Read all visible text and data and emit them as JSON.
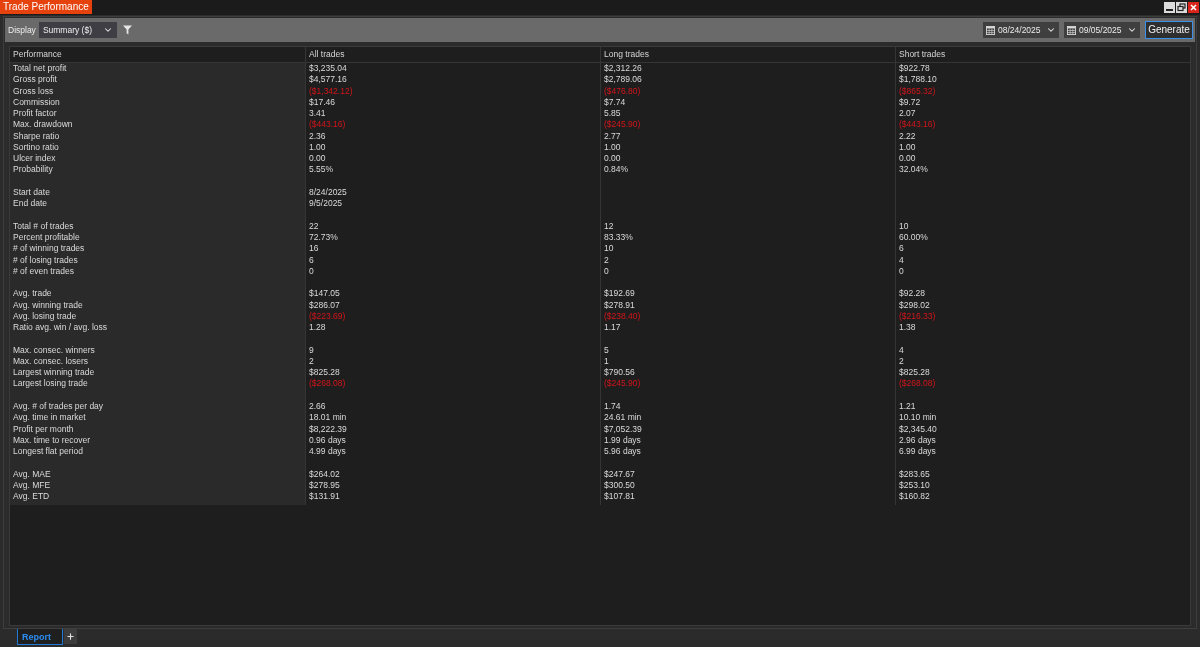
{
  "window": {
    "title": "Trade Performance"
  },
  "toolbar": {
    "display_label": "Display",
    "display_value": "Summary ($)",
    "dates": [
      "08/24/2025",
      "09/05/2025"
    ],
    "generate_button": "Generate"
  },
  "table": {
    "columns": [
      "Performance",
      "All trades",
      "Long trades",
      "Short trades"
    ],
    "sections": [
      {
        "rows": [
          {
            "label": "Total net profit",
            "values": [
              "$3,235.04",
              "$2,312.26",
              "$922.78"
            ],
            "negative": false
          },
          {
            "label": "Gross profit",
            "values": [
              "$4,577.16",
              "$2,789.06",
              "$1,788.10"
            ],
            "negative": false
          },
          {
            "label": "Gross loss",
            "values": [
              "($1,342.12)",
              "($476.80)",
              "($865.32)"
            ],
            "negative": true
          },
          {
            "label": "Commission",
            "values": [
              "$17.46",
              "$7.74",
              "$9.72"
            ],
            "negative": false
          },
          {
            "label": "Profit factor",
            "values": [
              "3.41",
              "5.85",
              "2.07"
            ],
            "negative": false
          },
          {
            "label": "Max. drawdown",
            "values": [
              "($443.16)",
              "($245.90)",
              "($443.16)"
            ],
            "negative": true
          },
          {
            "label": "Sharpe ratio",
            "values": [
              "2.36",
              "2.77",
              "2.22"
            ],
            "negative": false
          },
          {
            "label": "Sortino ratio",
            "values": [
              "1.00",
              "1.00",
              "1.00"
            ],
            "negative": false
          },
          {
            "label": "Ulcer index",
            "values": [
              "0.00",
              "0.00",
              "0.00"
            ],
            "negative": false
          },
          {
            "label": "Probability",
            "values": [
              "5.55%",
              "0.84%",
              "32.04%"
            ],
            "negative": false
          }
        ]
      },
      {
        "rows": [
          {
            "label": "Start date",
            "values": [
              "8/24/2025"
            ],
            "negative": false
          },
          {
            "label": "End date",
            "values": [
              "9/5/2025"
            ],
            "negative": false
          }
        ]
      },
      {
        "rows": [
          {
            "label": "Total # of trades",
            "values": [
              "22",
              "12",
              "10"
            ],
            "negative": false
          },
          {
            "label": "Percent profitable",
            "values": [
              "72.73%",
              "83.33%",
              "60.00%"
            ],
            "negative": false
          },
          {
            "label": "# of winning trades",
            "values": [
              "16",
              "10",
              "6"
            ],
            "negative": false
          },
          {
            "label": "# of losing trades",
            "values": [
              "6",
              "2",
              "4"
            ],
            "negative": false
          },
          {
            "label": "# of even trades",
            "values": [
              "0",
              "0",
              "0"
            ],
            "negative": false
          }
        ]
      },
      {
        "rows": [
          {
            "label": "Avg. trade",
            "values": [
              "$147.05",
              "$192.69",
              "$92.28"
            ],
            "negative": false
          },
          {
            "label": "Avg. winning trade",
            "values": [
              "$286.07",
              "$278.91",
              "$298.02"
            ],
            "negative": false
          },
          {
            "label": "Avg. losing trade",
            "values": [
              "($223.69)",
              "($238.40)",
              "($216.33)"
            ],
            "negative": true
          },
          {
            "label": "Ratio avg. win / avg. loss",
            "values": [
              "1.28",
              "1.17",
              "1.38"
            ],
            "negative": false
          }
        ]
      },
      {
        "rows": [
          {
            "label": "Max. consec. winners",
            "values": [
              "9",
              "5",
              "4"
            ],
            "negative": false
          },
          {
            "label": "Max. consec. losers",
            "values": [
              "2",
              "1",
              "2"
            ],
            "negative": false
          },
          {
            "label": "Largest winning trade",
            "values": [
              "$825.28",
              "$790.56",
              "$825.28"
            ],
            "negative": false
          },
          {
            "label": "Largest losing trade",
            "values": [
              "($268.08)",
              "($245.90)",
              "($268.08)"
            ],
            "negative": true
          }
        ]
      },
      {
        "rows": [
          {
            "label": "Avg. # of trades per day",
            "values": [
              "2.66",
              "1.74",
              "1.21"
            ],
            "negative": false
          },
          {
            "label": "Avg. time in market",
            "values": [
              "18.01 min",
              "24.61 min",
              "10.10 min"
            ],
            "negative": false
          },
          {
            "label": "Profit per month",
            "values": [
              "$8,222.39",
              "$7,052.39",
              "$2,345.40"
            ],
            "negative": false
          },
          {
            "label": "Max. time to recover",
            "values": [
              "0.96 days",
              "1.99 days",
              "2.96 days"
            ],
            "negative": false
          },
          {
            "label": "Longest flat period",
            "values": [
              "4.99 days",
              "5.96 days",
              "6.99 days"
            ],
            "negative": false
          }
        ]
      },
      {
        "rows": [
          {
            "label": "Avg. MAE",
            "values": [
              "$264.02",
              "$247.67",
              "$283.65"
            ],
            "negative": false
          },
          {
            "label": "Avg. MFE",
            "values": [
              "$278.95",
              "$300.50",
              "$253.10"
            ],
            "negative": false
          },
          {
            "label": "Avg. ETD",
            "values": [
              "$131.91",
              "$107.81",
              "$160.82"
            ],
            "negative": false
          }
        ]
      }
    ]
  },
  "tabs": [
    {
      "label": "Report",
      "selected": true
    }
  ]
}
